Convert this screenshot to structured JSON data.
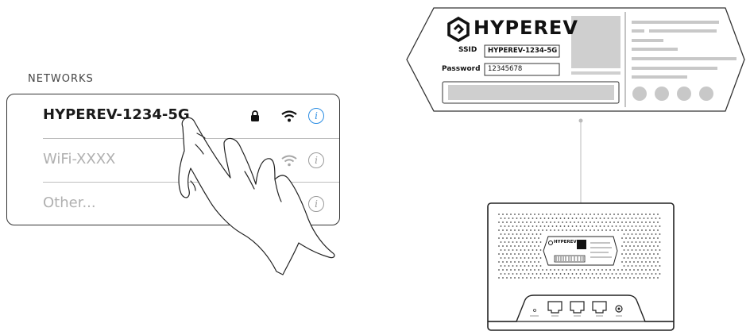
{
  "networks": {
    "heading": "NETWORKS",
    "items": [
      {
        "name": "HYPEREV-1234-5G",
        "selected": true,
        "lock_icon": "lock-icon",
        "wifi_icon": "wifi-icon",
        "info_icon": "info-icon"
      },
      {
        "name": "WiFi-XXXX",
        "selected": false,
        "wifi_icon": "wifi-icon",
        "info_icon": "info-icon"
      },
      {
        "name": "Other...",
        "selected": false,
        "info_icon": "info-icon"
      }
    ]
  },
  "label": {
    "brand": "HYPEREV",
    "ssid_label": "SSID",
    "ssid_value": "HYPEREV-1234-5G",
    "password_label": "Password",
    "password_value": "12345678"
  },
  "router": {
    "mini_brand": "HYPEREV"
  },
  "colors": {
    "accent": "#2b8de3",
    "dim_text": "#b0b0b0",
    "label_gray": "#c8c8c8"
  }
}
